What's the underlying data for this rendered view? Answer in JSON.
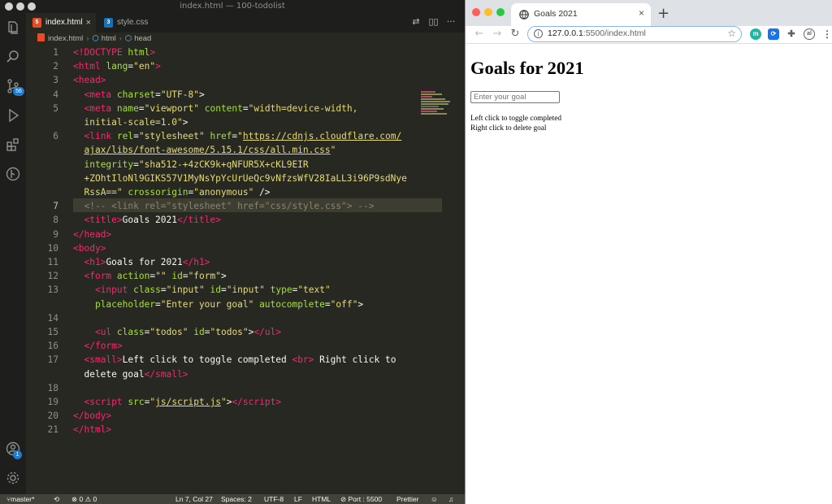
{
  "vscode": {
    "window_title": "index.html — 100-todolist",
    "tabs": [
      {
        "label": "index.html",
        "close": "×",
        "icon": "html5-icon"
      },
      {
        "label": "style.css",
        "icon": "css3-icon"
      }
    ],
    "tab_actions": [
      "⇄",
      "▯▯",
      "···"
    ],
    "breadcrumb": [
      "index.html",
      "html",
      "head"
    ],
    "activity_badges": {
      "source_control": "56",
      "accounts": "1"
    },
    "lines": [
      {
        "n": "1",
        "h": "<span class='tg'>&lt;!DOCTYPE</span> <span class='at'>html</span><span class='tg'>&gt;</span>"
      },
      {
        "n": "2",
        "h": "<span class='tg'>&lt;html</span> <span class='at'>lang</span>=<span class='st'>\"en\"</span><span class='tg'>&gt;</span>"
      },
      {
        "n": "3",
        "h": "<span class='tg'>&lt;head&gt;</span>"
      },
      {
        "n": "4",
        "h": "  <span class='tg'>&lt;meta</span> <span class='at'>charset</span>=<span class='st'>\"UTF-8\"</span>&gt;"
      },
      {
        "n": "5",
        "h": "  <span class='tg'>&lt;meta</span> <span class='at'>name</span>=<span class='st'>\"viewport\"</span> <span class='at'>content</span>=<span class='st'>\"width=device-width,</span>"
      },
      {
        "n": "",
        "h": "  <span class='st'>initial-scale=1.0\"</span>&gt;"
      },
      {
        "n": "6",
        "h": "  <span class='tg'>&lt;link</span> <span class='at'>rel</span>=<span class='st'>\"stylesheet\"</span> <span class='at'>href</span>=<span class='st'>\"<span class='ul'>https://cdnjs.cloudflare.com/</span></span>"
      },
      {
        "n": "",
        "h": "  <span class='st'><span class='ul'>ajax/libs/font-awesome/5.15.1/css/all.min.css</span>\"</span>"
      },
      {
        "n": "",
        "h": "  <span class='at'>integrity</span>=<span class='st'>\"sha512-+4zCK9k+qNFUR5X+cKL9EIR</span>"
      },
      {
        "n": "",
        "h": "  <span class='st'>+ZOhtIloNl9GIKS57V1MyNsYpYcUrUeQc9vNfzsWfV28IaLL3i96P9sdNye</span>"
      },
      {
        "n": "",
        "h": "  <span class='st'>RssA==\"</span> <span class='at'>crossorigin</span>=<span class='st'>\"anonymous\"</span> /&gt;"
      },
      {
        "n": "7",
        "h": "  <span class='cm'>&lt;!-- &lt;link rel=\"stylesheet\" href=\"css/style.css\"&gt; --&gt;</span>",
        "current": true
      },
      {
        "n": "8",
        "h": "  <span class='tg'>&lt;title&gt;</span>Goals 2021<span class='tg'>&lt;/title&gt;</span>"
      },
      {
        "n": "9",
        "h": "<span class='tg'>&lt;/head&gt;</span>"
      },
      {
        "n": "10",
        "h": "<span class='tg'>&lt;body&gt;</span>"
      },
      {
        "n": "11",
        "h": "  <span class='tg'>&lt;h1&gt;</span>Goals for 2021<span class='tg'>&lt;/h1&gt;</span>"
      },
      {
        "n": "12",
        "h": "  <span class='tg'>&lt;form</span> <span class='at'>action</span>=<span class='st'>\"\"</span> <span class='at'>id</span>=<span class='st'>\"form\"</span>&gt;"
      },
      {
        "n": "13",
        "h": "    <span class='tg'>&lt;input</span> <span class='at'>class</span>=<span class='st'>\"input\"</span> <span class='at'>id</span>=<span class='st'>\"input\"</span> <span class='at'>type</span>=<span class='st'>\"text\"</span>"
      },
      {
        "n": "",
        "h": "    <span class='at'>placeholder</span>=<span class='st'>\"Enter your goal\"</span> <span class='at'>autocomplete</span>=<span class='st'>\"off\"</span>&gt;"
      },
      {
        "n": "14",
        "h": ""
      },
      {
        "n": "15",
        "h": "    <span class='tg'>&lt;ul</span> <span class='at'>class</span>=<span class='st'>\"todos\"</span> <span class='at'>id</span>=<span class='st'>\"todos\"</span>&gt;<span class='tg'>&lt;/ul&gt;</span>"
      },
      {
        "n": "16",
        "h": "  <span class='tg'>&lt;/form&gt;</span>"
      },
      {
        "n": "17",
        "h": "  <span class='tg'>&lt;small&gt;</span>Left click to toggle completed <span class='tg'>&lt;br&gt;</span> Right click to"
      },
      {
        "n": "",
        "h": "  delete goal<span class='tg'>&lt;/small&gt;</span>"
      },
      {
        "n": "18",
        "h": ""
      },
      {
        "n": "19",
        "h": "  <span class='tg'>&lt;script</span> <span class='at'>src</span>=<span class='st'>\"<span class='ul'>js/script.js</span>\"</span>&gt;<span class='tg'>&lt;/script&gt;</span>"
      },
      {
        "n": "20",
        "h": "<span class='tg'>&lt;/body&gt;</span>"
      },
      {
        "n": "21",
        "h": "<span class='tg'>&lt;/html&gt;</span>"
      }
    ],
    "status": {
      "branch": "master*",
      "problems": "⊗ 0 ⚠ 0",
      "position": "Ln 7, Col 27",
      "spaces": "Spaces: 2",
      "encoding": "UTF-8",
      "eol": "LF",
      "language": "HTML",
      "port": "⊘ Port : 5500",
      "prettier": "Prettier"
    },
    "colors": {
      "bg": "#272822",
      "tag": "#f92672",
      "attr": "#a6e22e",
      "string": "#e6db74",
      "comment": "#88846f"
    }
  },
  "browser": {
    "tab_title": "Goals 2021",
    "tab_close": "×",
    "new_tab": "+",
    "url_host": "127.0.0.1",
    "url_path": ":5500/index.html",
    "nav": {
      "back": "←",
      "forward": "→",
      "reload": "↻"
    },
    "page": {
      "heading": "Goals for 2021",
      "input_placeholder": "Enter your goal",
      "hint_line1": "Left click to toggle completed",
      "hint_line2": "Right click to delete goal"
    }
  }
}
